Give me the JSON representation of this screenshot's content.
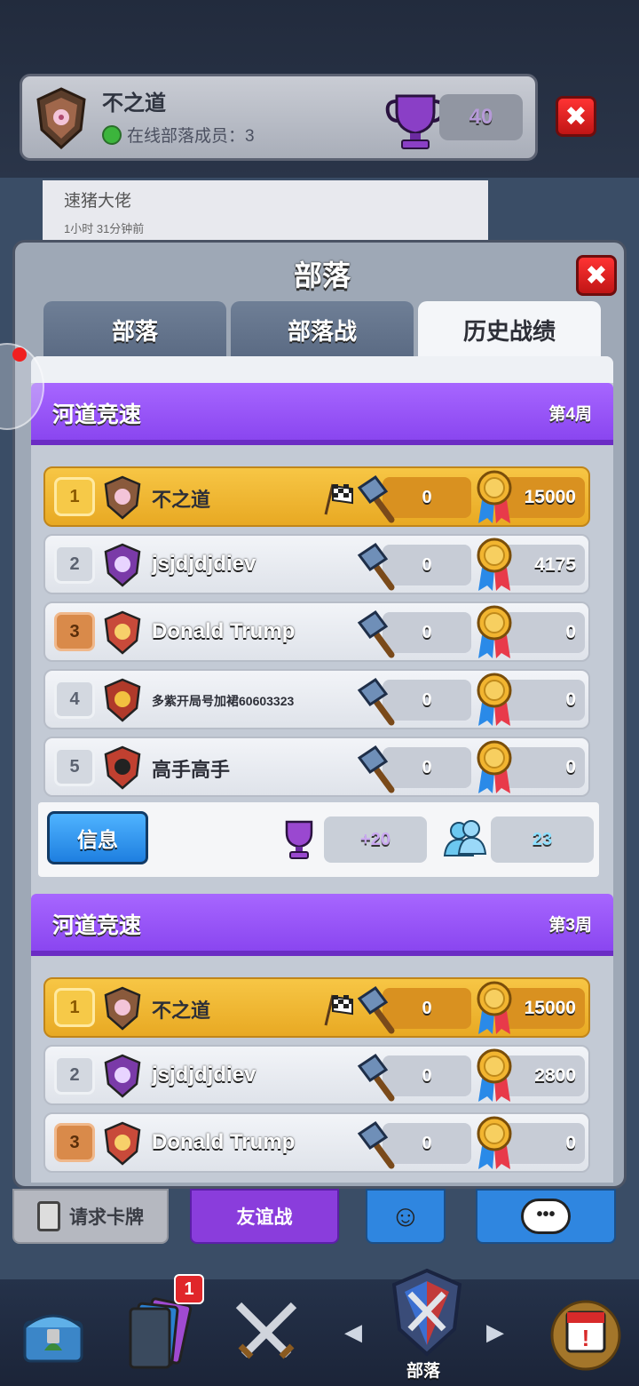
{
  "header": {
    "clan_name": "不之道",
    "online_label": "在线部落成员：3",
    "trophies": "40"
  },
  "chat": {
    "sender": "速猪大佬",
    "time": "1小时 31分钟前"
  },
  "panel": {
    "title": "部落",
    "tabs": [
      "部落",
      "部落战",
      "历史战绩"
    ],
    "active_tab": 2
  },
  "sections": [
    {
      "name": "河道竞速",
      "week": "第4周",
      "rows": [
        {
          "rank": "1",
          "name": "不之道",
          "finished": true,
          "hammer": "0",
          "medals": "15000"
        },
        {
          "rank": "2",
          "name": "jsjdjdjdiev",
          "finished": false,
          "hammer": "0",
          "medals": "4175"
        },
        {
          "rank": "3",
          "name": "Donald Trump",
          "finished": false,
          "hammer": "0",
          "medals": "0"
        },
        {
          "rank": "4",
          "name": "多紫开局号加裙60603323",
          "finished": false,
          "hammer": "0",
          "medals": "0"
        },
        {
          "rank": "5",
          "name": "高手高手",
          "finished": false,
          "hammer": "0",
          "medals": "0"
        }
      ],
      "footer": {
        "info_label": "信息",
        "trophy_change": "+20",
        "members": "23"
      }
    },
    {
      "name": "河道竞速",
      "week": "第3周",
      "rows": [
        {
          "rank": "1",
          "name": "不之道",
          "finished": true,
          "hammer": "0",
          "medals": "15000"
        },
        {
          "rank": "2",
          "name": "jsjdjdjdiev",
          "finished": false,
          "hammer": "0",
          "medals": "2800"
        },
        {
          "rank": "3",
          "name": "Donald Trump",
          "finished": false,
          "hammer": "0",
          "medals": "0"
        }
      ]
    }
  ],
  "bottom_buttons": {
    "request_cards": "请求卡牌",
    "friendly_battle": "友谊战"
  },
  "nav": {
    "clan_label": "部落",
    "cards_badge": "1"
  },
  "colors": {
    "purple": "#9a56f8",
    "gold": "#f2bd3c",
    "blue": "#2a8ff0",
    "red": "#e0262a"
  }
}
